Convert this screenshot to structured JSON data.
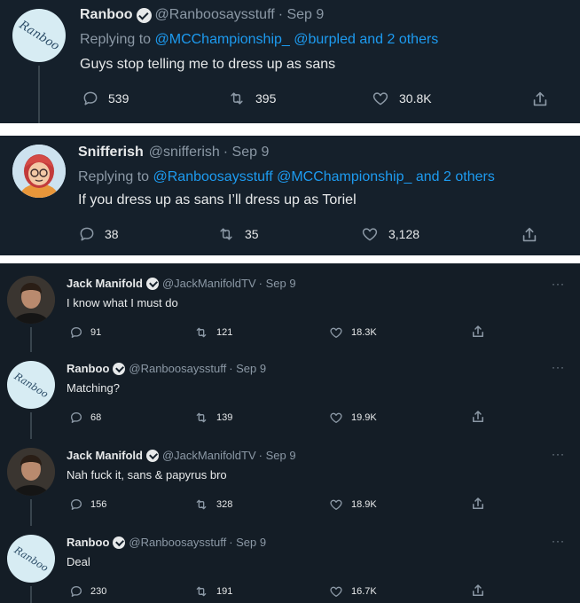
{
  "panel1": {
    "name": "Ranboo",
    "handle": "@Ranboosaysstuff",
    "date": "· Sep 9",
    "avatar_text": "Ranboo",
    "replying_prefix": "Replying to",
    "replying_links": "@MCChampionship_ @burpled",
    "replying_suffix_and": "and",
    "replying_others": "2 others",
    "text": "Guys stop telling me to dress up as sans",
    "replies": "539",
    "retweets": "395",
    "likes": "30.8K"
  },
  "panel2": {
    "name": "Snifferish",
    "handle": "@snifferish",
    "date": "· Sep 9",
    "replying_prefix": "Replying to",
    "replying_links": "@Ranboosaysstuff @MCChampionship_",
    "replying_suffix_and": "and",
    "replying_others": "2 others",
    "text": "If you dress up as sans I’ll dress up as Toriel",
    "replies": "38",
    "retweets": "35",
    "likes": "3,128"
  },
  "thread": [
    {
      "name": "Jack Manifold",
      "handle": "@JackManifoldTV",
      "date": "· Sep 9",
      "avatar": "jack",
      "text": "I know what I must do",
      "replies": "91",
      "retweets": "121",
      "likes": "18.3K"
    },
    {
      "name": "Ranboo",
      "handle": "@Ranboosaysstuff",
      "date": "· Sep 9",
      "avatar": "ranboo",
      "avatar_text": "Ranboo",
      "text": "Matching?",
      "replies": "68",
      "retweets": "139",
      "likes": "19.9K"
    },
    {
      "name": "Jack Manifold",
      "handle": "@JackManifoldTV",
      "date": "· Sep 9",
      "avatar": "jack",
      "text": "Nah fuck it, sans & papyrus bro",
      "replies": "156",
      "retweets": "328",
      "likes": "18.9K"
    },
    {
      "name": "Ranboo",
      "handle": "@Ranboosaysstuff",
      "date": "· Sep 9",
      "avatar": "ranboo",
      "avatar_text": "Ranboo",
      "text": "Deal",
      "replies": "230",
      "retweets": "191",
      "likes": "16.7K"
    }
  ],
  "more_glyph": "···",
  "colors": {
    "background": "#15202b",
    "text": "#e7e9ea",
    "muted": "#8b98a5",
    "link": "#1d9bf0",
    "separator": "#ffffff"
  }
}
